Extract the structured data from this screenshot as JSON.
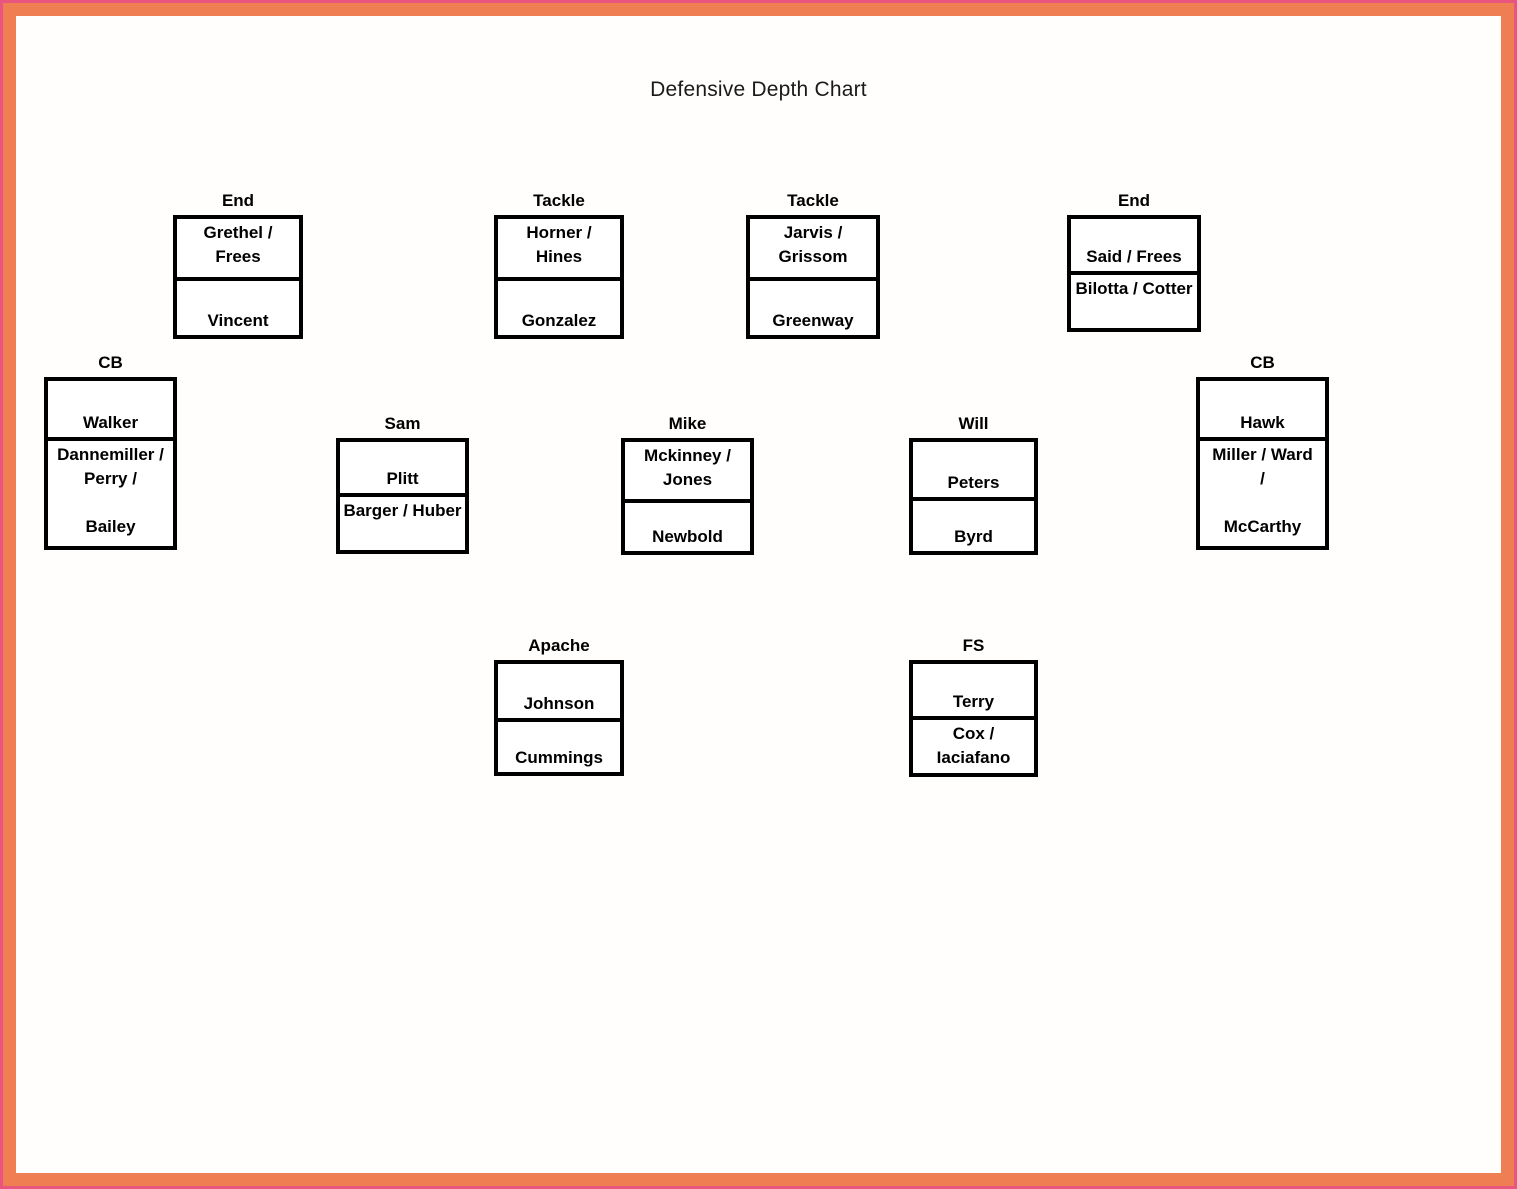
{
  "title": "Defensive Depth Chart",
  "frame": {
    "outer_color": "#e8557f",
    "band_color": "#ef7f52",
    "page_color": "#fffefd"
  },
  "chart_data": {
    "type": "table",
    "title": "Defensive Depth Chart",
    "description": "Football defensive depth chart with position groups; each box lists first-string on top and backups below.",
    "rows": [
      {
        "row_name": "defensive-line",
        "groups": [
          {
            "position": "End",
            "depth": [
              "Grethel / Frees",
              "Vincent"
            ]
          },
          {
            "position": "Tackle",
            "depth": [
              "Horner / Hines",
              "Gonzalez"
            ]
          },
          {
            "position": "Tackle",
            "depth": [
              "Jarvis / Grissom",
              "Greenway"
            ]
          },
          {
            "position": "End",
            "depth": [
              "Said / Frees",
              "Bilotta / Cotter"
            ]
          }
        ]
      },
      {
        "row_name": "linebackers-and-corners",
        "groups": [
          {
            "position": "CB",
            "depth": [
              "Walker",
              "Dannemiller / Perry / Bailey"
            ]
          },
          {
            "position": "Sam",
            "depth": [
              "Plitt",
              "Barger / Huber"
            ]
          },
          {
            "position": "Mike",
            "depth": [
              "Mckinney / Jones",
              "Newbold"
            ]
          },
          {
            "position": "Will",
            "depth": [
              "Peters",
              "Byrd"
            ]
          },
          {
            "position": "CB",
            "depth": [
              "Hawk",
              "Miller / Ward / McCarthy"
            ]
          }
        ]
      },
      {
        "row_name": "safeties",
        "groups": [
          {
            "position": "Apache",
            "depth": [
              "Johnson",
              "Cummings"
            ]
          },
          {
            "position": "FS",
            "depth": [
              "Terry",
              "Cox / Iaciafano"
            ]
          }
        ]
      }
    ]
  },
  "groups": {
    "end_left": {
      "label": "End",
      "cell1": "Grethel / Frees",
      "cell2": "Vincent"
    },
    "tackle_left": {
      "label": "Tackle",
      "cell1": "Horner / Hines",
      "cell2": "Gonzalez"
    },
    "tackle_right": {
      "label": "Tackle",
      "cell1": "Jarvis / Grissom",
      "cell2": "Greenway"
    },
    "end_right": {
      "label": "End",
      "cell1": "Said / Frees",
      "cell2": "Bilotta / Cotter"
    },
    "cb_left": {
      "label": "CB",
      "cell1": "Walker",
      "cell2_line1": "Dannemiller /",
      "cell2_line2": "Perry /",
      "cell2_line3": "Bailey"
    },
    "sam": {
      "label": "Sam",
      "cell1": "Plitt",
      "cell2": "Barger / Huber"
    },
    "mike": {
      "label": "Mike",
      "cell1": "Mckinney / Jones",
      "cell2": "Newbold"
    },
    "will": {
      "label": "Will",
      "cell1": "Peters",
      "cell2": "Byrd"
    },
    "cb_right": {
      "label": "CB",
      "cell1": "Hawk",
      "cell2_line1": "Miller / Ward",
      "cell2_line2": "/",
      "cell2_line3": "McCarthy"
    },
    "apache": {
      "label": "Apache",
      "cell1": "Johnson",
      "cell2": "Cummings"
    },
    "fs": {
      "label": "FS",
      "cell1": "Terry",
      "cell2": "Cox / Iaciafano"
    }
  }
}
